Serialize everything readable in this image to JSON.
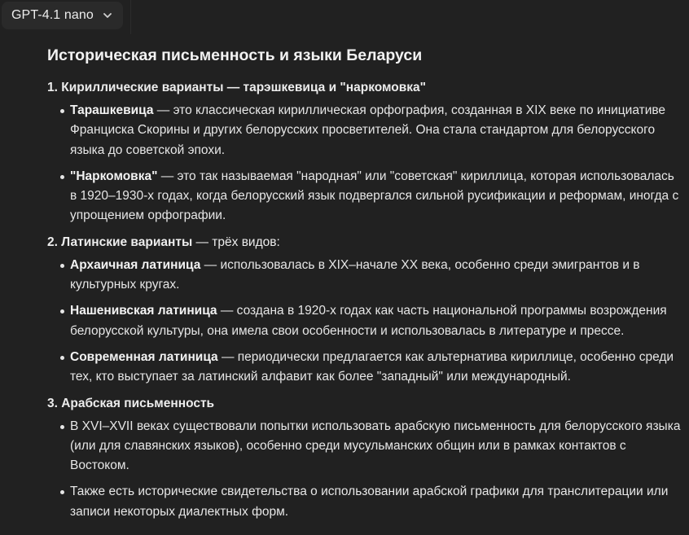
{
  "header": {
    "model_name": "GPT-4.1 nano"
  },
  "article": {
    "title": "Историческая письменность и языки Беларуси",
    "sections": [
      {
        "heading_bold": "1. Кириллические варианты — тарэшкевица и \"наркомовка\"",
        "heading_rest": "",
        "items": [
          {
            "term": "Тарашкевица",
            "text": " — это классическая кириллическая орфография, созданная в XIX веке по инициативе Франциска Скорины и других белорусских просветителей. Она стала стандартом для белорусского языка до советской эпохи."
          },
          {
            "term": "\"Наркомовка\"",
            "text": " — это так называемая \"народная\" или \"советская\" кириллица, которая использовалась в 1920–1930-х годах, когда белорусский язык подвергался сильной русификации и реформам, иногда с упрощением орфографии."
          }
        ]
      },
      {
        "heading_bold": "2. Латинские варианты",
        "heading_rest": " — трёх видов:",
        "items": [
          {
            "term": "Архаичная латиница",
            "text": " — использовалась в XIX–начале XX века, особенно среди эмигрантов и в культурных кругах."
          },
          {
            "term": "Нашенивская латиница",
            "text": " — создана в 1920-х годах как часть национальной программы возрождения белорусской культуры, она имела свои особенности и использовалась в литературе и прессе."
          },
          {
            "term": "Современная латиница",
            "text": " — периодически предлагается как альтернатива кириллице, особенно среди тех, кто выступает за латинский алфавит как более \"западный\" или международный."
          }
        ]
      },
      {
        "heading_bold": "3. Арабская письменность",
        "heading_rest": "",
        "items": [
          {
            "term": "",
            "text": "В XVI–XVII веках существовали попытки использовать арабскую письменность для белорусского языка (или для славянских языков), особенно среди мусульманских общин или в рамках контактов с Востоком."
          },
          {
            "term": "",
            "text": "Также есть исторические свидетельства о использовании арабской графики для транслитерации или записи некоторых диалектных форм."
          }
        ]
      }
    ]
  },
  "icons": {
    "model_dropdown": "chevron-down-icon"
  }
}
